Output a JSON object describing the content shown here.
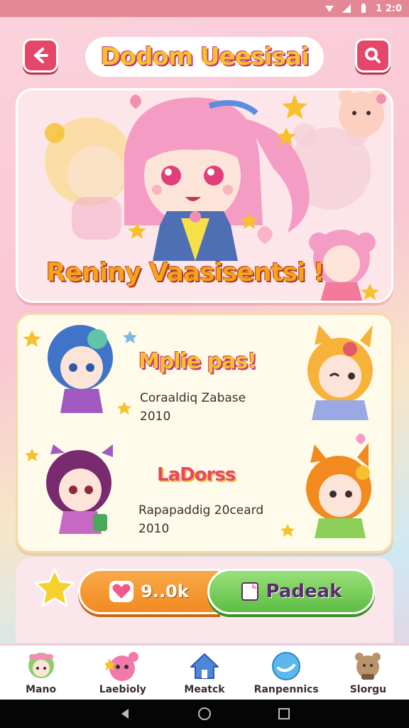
{
  "status_bar": {
    "time": "1 2:0",
    "icons": [
      "signal-icon",
      "network-icon",
      "battery-icon"
    ]
  },
  "header": {
    "title": "Dodom Ueesisai",
    "back_icon": "back-arrow-icon",
    "search_icon": "search-icon"
  },
  "hero": {
    "caption": "Reniny Vaasisentsi !"
  },
  "items": [
    {
      "title": "Mplie pas!",
      "line1": "Coraaldiq Zabase",
      "line2": "2010"
    },
    {
      "title": "LaDorss",
      "line1": "Rapapaddig 20ceard",
      "line2": "2010"
    }
  ],
  "actions": {
    "likes": "9..0k",
    "primary_label": "Padeak"
  },
  "bottom_nav": [
    {
      "label": "Mano",
      "icon": "home-character-icon"
    },
    {
      "label": "Laebioly",
      "icon": "pink-blob-icon"
    },
    {
      "label": "Meatck",
      "icon": "house-icon"
    },
    {
      "label": "Ranpennics",
      "icon": "globe-icon"
    },
    {
      "label": "Slorgu",
      "icon": "bear-icon"
    }
  ],
  "colors": {
    "accent": "#e5476a",
    "title_yellow": "#f6c12c",
    "orange": "#f28a20",
    "green": "#5cbd44"
  }
}
